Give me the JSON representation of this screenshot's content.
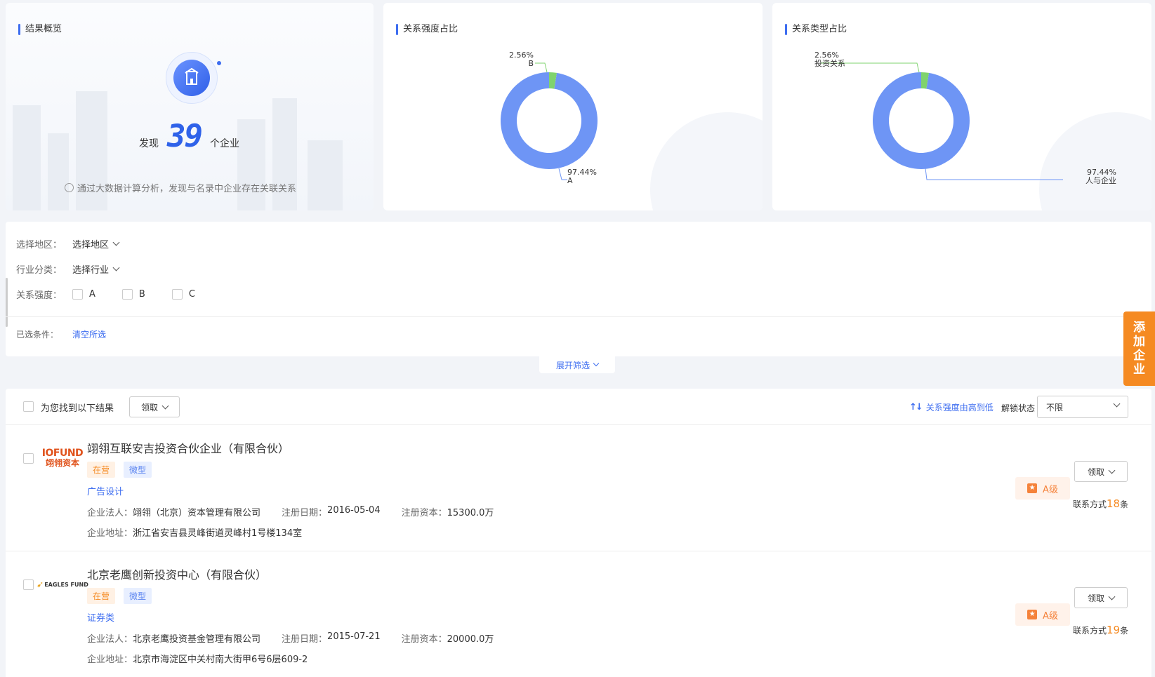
{
  "overview": {
    "title": "结果概览",
    "found_prefix": "发现",
    "found_count": "39",
    "found_suffix": "个企业",
    "note": "通过大数据计算分析，发现与名录中企业存在关联关系"
  },
  "strength_chart": {
    "title": "关系强度占比",
    "label_b_pct": "2.56%",
    "label_b_name": "B",
    "label_a_pct": "97.44%",
    "label_a_name": "A"
  },
  "type_chart": {
    "title": "关系类型占比",
    "label_small_pct": "2.56%",
    "label_small_name": "投资关系",
    "label_large_pct": "97.44%",
    "label_large_name": "人与企业"
  },
  "chart_data": [
    {
      "type": "pie",
      "title": "关系强度占比",
      "categories": [
        "A",
        "B"
      ],
      "values": [
        97.44,
        2.56
      ],
      "colors": [
        "#6e95f5",
        "#7fd36e"
      ]
    },
    {
      "type": "pie",
      "title": "关系类型占比",
      "categories": [
        "人与企业",
        "投资关系"
      ],
      "values": [
        97.44,
        2.56
      ],
      "colors": [
        "#6e95f5",
        "#7fd36e"
      ]
    }
  ],
  "filters": {
    "region_label": "选择地区：",
    "region_value": "选择地区",
    "industry_label": "行业分类：",
    "industry_value": "选择行业",
    "strength_label": "关系强度：",
    "strength_options": [
      "A",
      "B",
      "C"
    ],
    "selected_label": "已选条件：",
    "clear_label": "清空所选",
    "expand_label": "展开筛选"
  },
  "side_tab": {
    "chars": [
      "添",
      "加",
      "企",
      "业"
    ]
  },
  "results": {
    "header_text": "为您找到以下结果",
    "claim_label": "领取",
    "sort_label": "关系强度由高到低",
    "unlock_label": "解锁状态",
    "unlock_value": "不限",
    "items": [
      {
        "name": "翊翎互联安吉投资合伙企业（有限合伙）",
        "logo_line1": "IOFUND",
        "logo_line2": "翊翎资本",
        "tag_status": "在营",
        "tag_size": "微型",
        "industry": "广告设计",
        "legal_label": "企业法人：",
        "legal_value": "翊翎（北京）资本管理有限公司",
        "date_label": "注册日期：",
        "date_value": "2016-05-04",
        "capital_label": "注册资本：",
        "capital_value": "15300.0万",
        "address_label": "企业地址：",
        "address_value": "浙江省安吉县灵峰街道灵峰村1号楼134室",
        "grade": "A级",
        "claim": "领取",
        "contact_prefix": "联系方式",
        "contact_count": "18",
        "contact_suffix": "条"
      },
      {
        "name": "北京老鹰创新投资中心（有限合伙）",
        "logo_line1": "EAGLES FUND",
        "logo_line2": "",
        "tag_status": "在营",
        "tag_size": "微型",
        "industry": "证券类",
        "legal_label": "企业法人：",
        "legal_value": "北京老鹰投资基金管理有限公司",
        "date_label": "注册日期：",
        "date_value": "2015-07-21",
        "capital_label": "注册资本：",
        "capital_value": "20000.0万",
        "address_label": "企业地址：",
        "address_value": "北京市海淀区中关村南大街甲6号6层609-2",
        "grade": "A级",
        "claim": "领取",
        "contact_prefix": "联系方式",
        "contact_count": "19",
        "contact_suffix": "条"
      }
    ]
  }
}
